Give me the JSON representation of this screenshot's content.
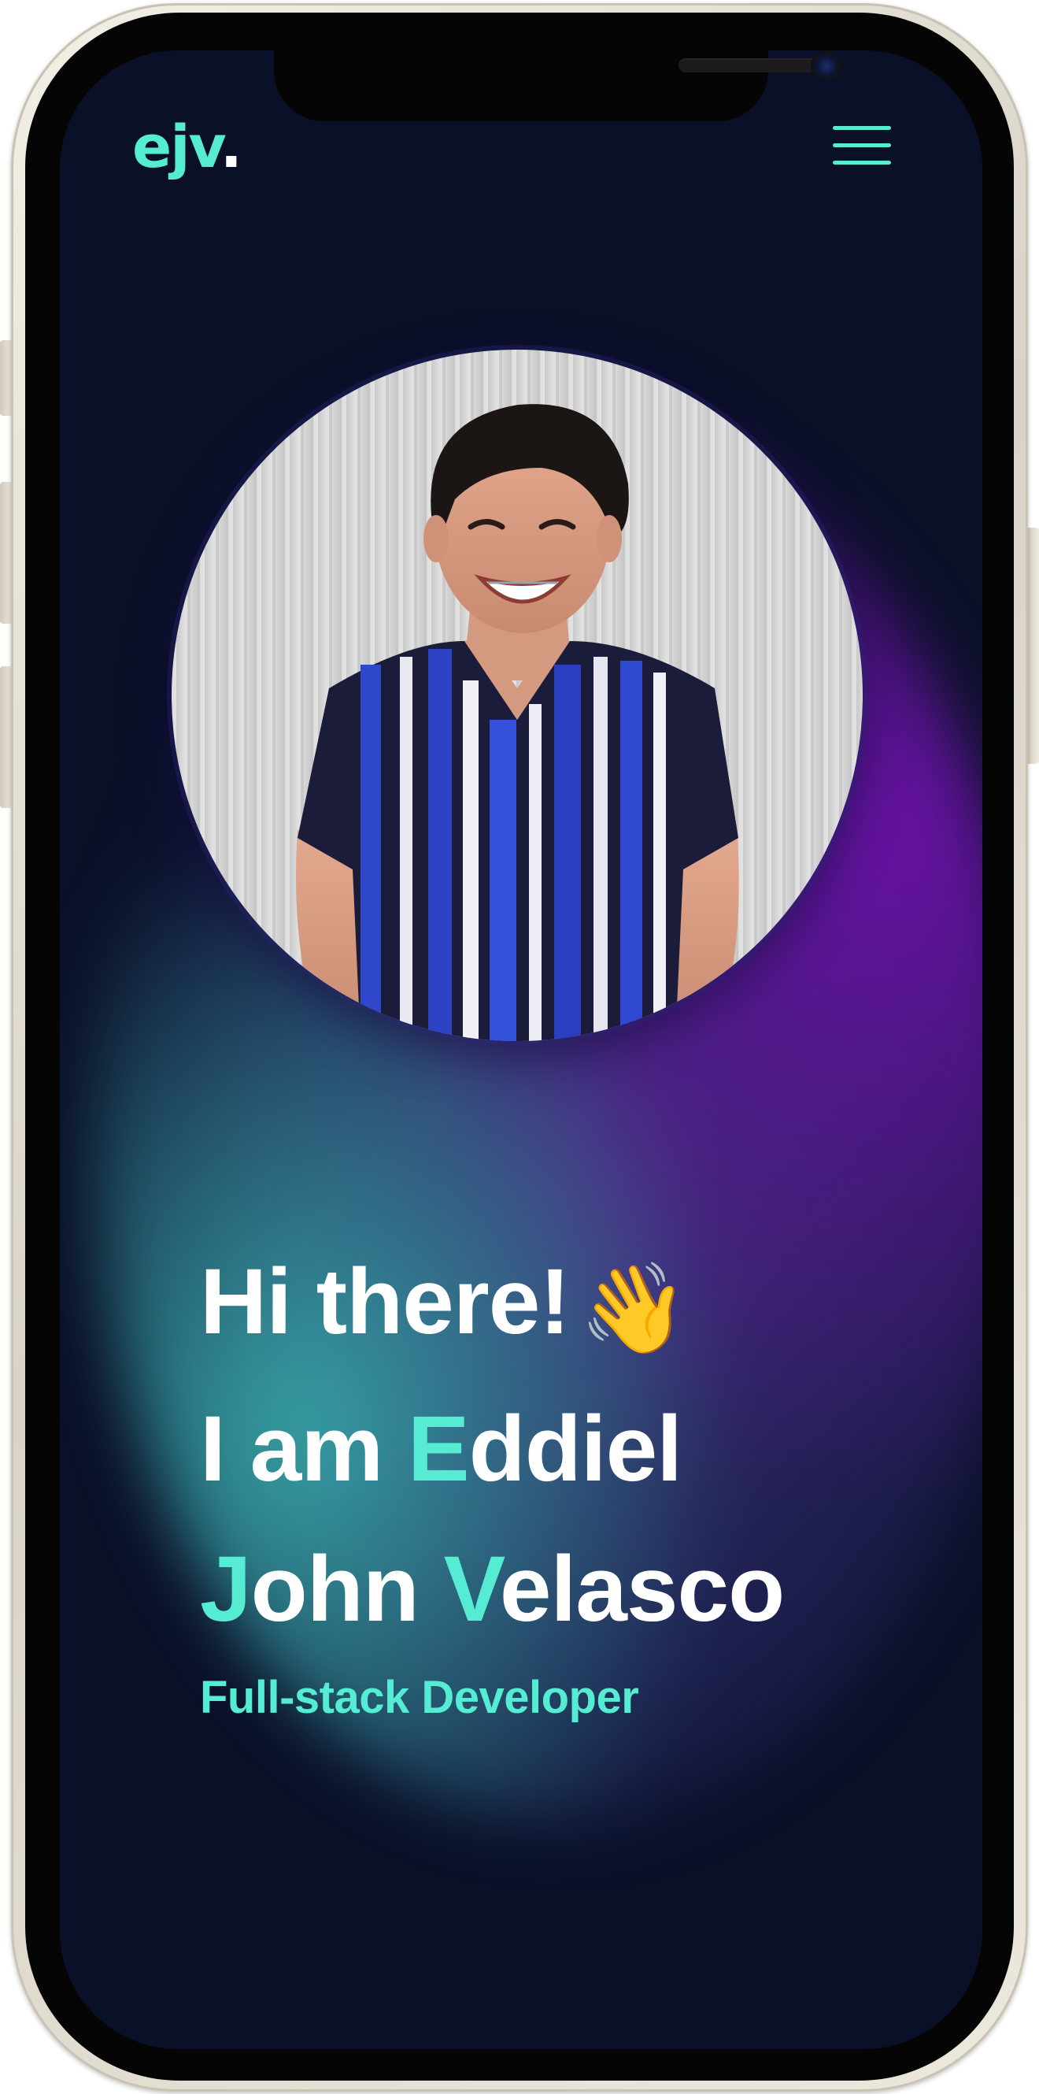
{
  "brand": {
    "logo_text": "ejv",
    "logo_dot": "."
  },
  "nav": {
    "menu_icon": "hamburger-menu-icon"
  },
  "hero": {
    "greeting": "Hi there!",
    "greeting_emoji": "👋",
    "intro": "I am ",
    "first_initial": "E",
    "first_rest": "ddiel",
    "middle_initial": "J",
    "middle_rest": "ohn ",
    "last_initial": "V",
    "last_rest": "elasco",
    "role": "Full-stack Developer"
  },
  "colors": {
    "background": "#0b1029",
    "accent": "#56ecd4",
    "text": "#ffffff",
    "glow_teal": "#3ec4bd",
    "glow_purple": "#6c12a8"
  },
  "media": {
    "profile_photo": "profile-photo"
  }
}
